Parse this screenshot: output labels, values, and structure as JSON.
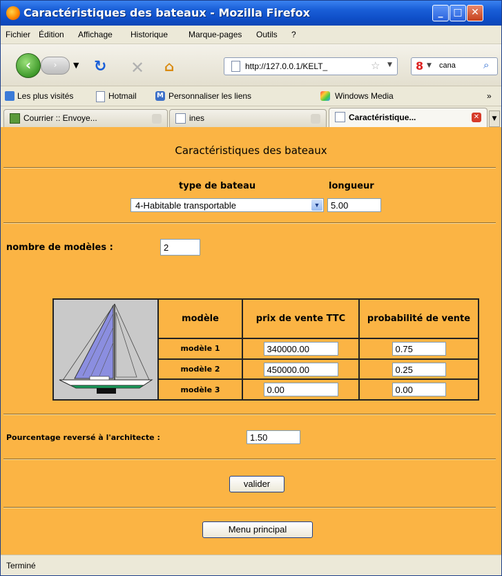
{
  "window": {
    "title": "Caractéristiques des bateaux - Mozilla Firefox"
  },
  "menu": {
    "items": [
      "Fichier",
      "Édition",
      "Affichage",
      "Historique",
      "Marque-pages",
      "Outils",
      "?"
    ]
  },
  "nav": {
    "url": "http://127.0.0.1/KELT_",
    "search_text": "cana",
    "search_engine_glyph": "8"
  },
  "bookmarks": {
    "items": [
      "Les plus visités",
      "Hotmail",
      "Personnaliser les liens",
      "Windows Media"
    ],
    "overflow": "»"
  },
  "tabs": [
    {
      "label": "Courrier :: Envoye...",
      "active": false
    },
    {
      "label": "ines",
      "active": false
    },
    {
      "label": "Caractéristique...",
      "active": true
    }
  ],
  "page": {
    "heading": "Caractéristiques des bateaux",
    "type_label": "type de bateau",
    "type_value": "4-Habitable transportable",
    "length_label": "longueur",
    "length_value": "5.00",
    "models_count_label": "nombre de modèles :",
    "models_count_value": "2",
    "table": {
      "headers": [
        "modèle",
        "prix de vente TTC",
        "probabilité de vente"
      ],
      "rows": [
        {
          "label": "modèle 1",
          "price": "340000.00",
          "prob": "0.75"
        },
        {
          "label": "modèle 2",
          "price": "450000.00",
          "prob": "0.25"
        },
        {
          "label": "modèle 3",
          "price": "0.00",
          "prob": "0.00"
        }
      ]
    },
    "architect_label": "Pourcentage reversé à l'architecte :",
    "architect_value": "1.50",
    "validate_button": "valider",
    "main_menu_button": "Menu principal"
  },
  "status": {
    "text": "Terminé"
  },
  "colors": {
    "page_bg": "#fbb444",
    "titlebar": "#0f4fc9"
  }
}
